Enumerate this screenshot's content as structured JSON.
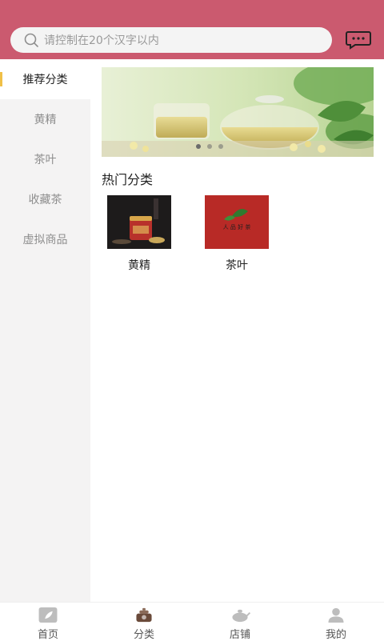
{
  "search": {
    "placeholder": "请控制在20个汉字以内"
  },
  "sidebar": {
    "items": [
      {
        "label": "推荐分类"
      },
      {
        "label": "黄精"
      },
      {
        "label": "茶叶"
      },
      {
        "label": "收藏茶"
      },
      {
        "label": "虚拟商品"
      }
    ]
  },
  "main": {
    "section_title": "热门分类",
    "categories": [
      {
        "label": "黄精"
      },
      {
        "label": "茶叶",
        "thumb_text": "人 品 好 茶"
      }
    ]
  },
  "tabbar": {
    "items": [
      {
        "label": "首页",
        "icon": "leaf-icon"
      },
      {
        "label": "分类",
        "icon": "teapot-icon"
      },
      {
        "label": "店铺",
        "icon": "kettle-icon"
      },
      {
        "label": "我的",
        "icon": "user-icon"
      }
    ]
  },
  "colors": {
    "header": "#cb5a6f",
    "sidebar_accent": "#f0c048",
    "sidebar_bg": "#f4f3f3"
  }
}
